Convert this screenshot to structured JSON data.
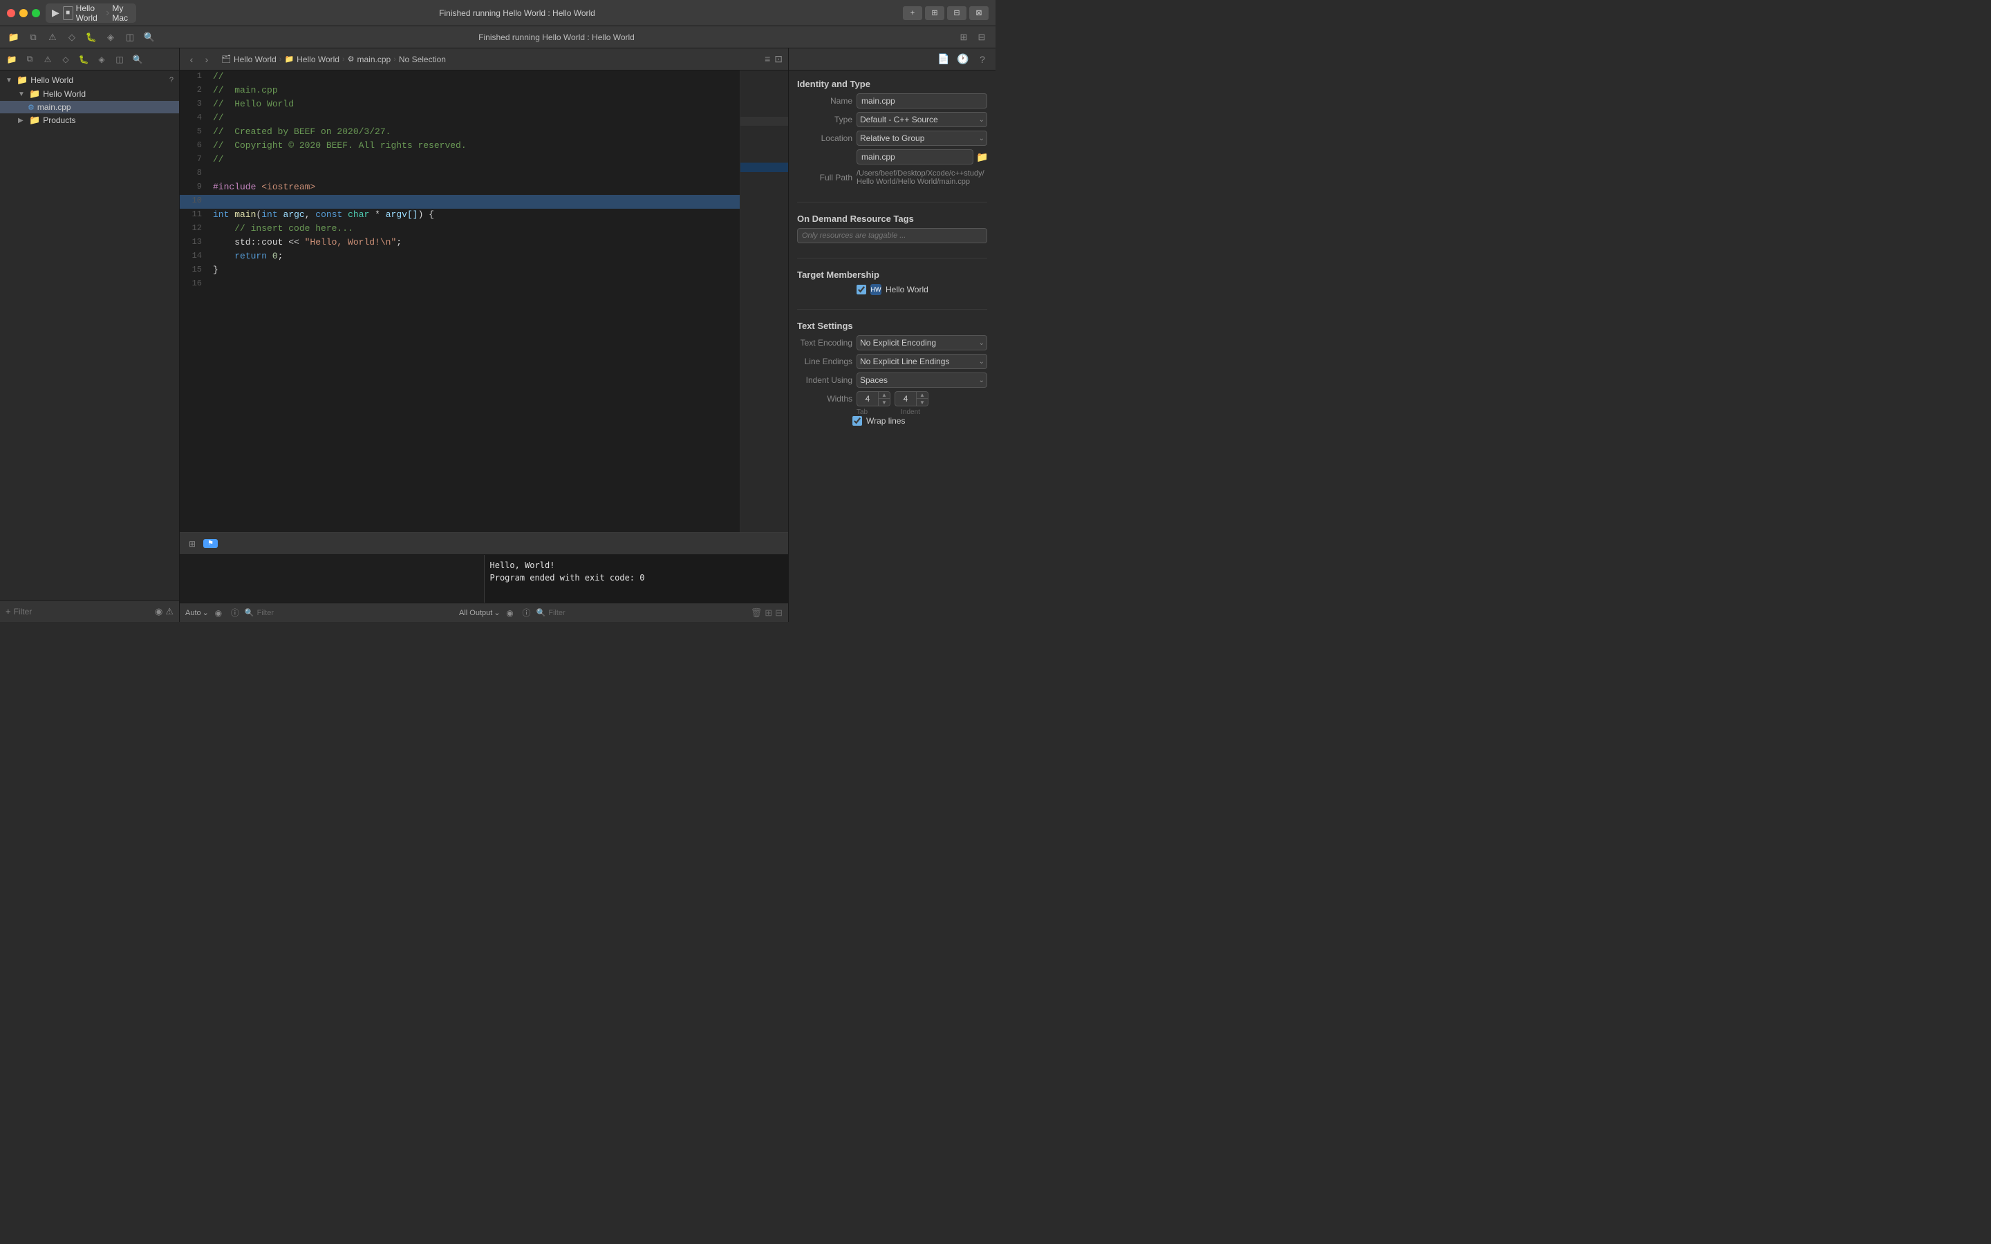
{
  "titlebar": {
    "title": "Finished running Hello World : Hello World",
    "scheme": "Hello World",
    "destination": "My Mac",
    "play_label": "▶",
    "stop_label": "■",
    "add_btn": "+",
    "layout_btns": [
      "⊞",
      "⊟",
      "⊠"
    ]
  },
  "statusbar": {
    "icons": [
      "≡",
      "□",
      "▤",
      "○",
      "◇",
      "◈",
      "◫",
      "◻"
    ],
    "right_icons": [
      "⊞",
      "⊟"
    ]
  },
  "navigator": {
    "items": [
      {
        "label": "Hello World",
        "level": 0,
        "type": "group",
        "disclosure": "▼"
      },
      {
        "label": "Hello World",
        "level": 1,
        "type": "folder",
        "disclosure": "▼"
      },
      {
        "label": "main.cpp",
        "level": 2,
        "type": "file",
        "selected": true
      },
      {
        "label": "Products",
        "level": 1,
        "type": "folder",
        "disclosure": "▶"
      }
    ],
    "filter_placeholder": "Filter",
    "badge": "?"
  },
  "breadcrumb": {
    "nav_back": "‹",
    "nav_forward": "›",
    "items": [
      {
        "icon": "🗂",
        "label": "Hello World"
      },
      {
        "icon": "📁",
        "label": "Hello World"
      },
      {
        "icon": "⚙",
        "label": "main.cpp"
      },
      {
        "label": "No Selection"
      }
    ],
    "right_btns": [
      "≡",
      "⊡"
    ]
  },
  "code": {
    "lines": [
      {
        "num": 1,
        "content": "//"
      },
      {
        "num": 2,
        "content": "//  main.cpp"
      },
      {
        "num": 3,
        "content": "//  Hello World"
      },
      {
        "num": 4,
        "content": "//"
      },
      {
        "num": 5,
        "content": "//  Created by BEEF on 2020/3/27."
      },
      {
        "num": 6,
        "content": "//  Copyright © 2020 BEEF. All rights reserved."
      },
      {
        "num": 7,
        "content": "//"
      },
      {
        "num": 8,
        "content": ""
      },
      {
        "num": 9,
        "content": "#include <iostream>"
      },
      {
        "num": 10,
        "content": "",
        "highlighted": true
      },
      {
        "num": 11,
        "content": "int main(int argc, const char * argv[]) {"
      },
      {
        "num": 12,
        "content": "    // insert code here..."
      },
      {
        "num": 13,
        "content": "    std::cout << \"Hello, World!\\n\";"
      },
      {
        "num": 14,
        "content": "    return 0;"
      },
      {
        "num": 15,
        "content": "}"
      },
      {
        "num": 16,
        "content": ""
      }
    ]
  },
  "terminal": {
    "auto_label": "Auto",
    "left_filter": "Filter",
    "all_output_label": "All Output",
    "right_filter": "Filter",
    "output_text": "Hello, World!\nProgram ended with exit code: 0",
    "icons": {
      "collapse": "⊞",
      "flag": "⚑"
    }
  },
  "inspector": {
    "title": "Identity and Type",
    "name_label": "Name",
    "name_value": "main.cpp",
    "type_label": "Type",
    "type_value": "Default - C++ Source",
    "location_label": "Location",
    "location_value": "Relative to Group",
    "file_label": "main.cpp",
    "full_path_label": "Full Path",
    "full_path_value": "/Users/beef/Desktop/Xcode/c++study/Hello World/Hello World/main.cpp",
    "on_demand_title": "On Demand Resource Tags",
    "tags_placeholder": "Only resources are taggable ...",
    "target_title": "Target Membership",
    "target_name": "Hello World",
    "text_settings_title": "Text Settings",
    "encoding_label": "Text Encoding",
    "encoding_value": "No Explicit Encoding",
    "line_endings_label": "Line Endings",
    "line_endings_value": "No Explicit Line Endings",
    "indent_label": "Indent Using",
    "indent_value": "Spaces",
    "widths_label": "Widths",
    "tab_width": "4",
    "indent_width": "4",
    "tab_label": "Tab",
    "indent_label2": "Indent",
    "wrap_lines_label": "Wrap lines"
  }
}
